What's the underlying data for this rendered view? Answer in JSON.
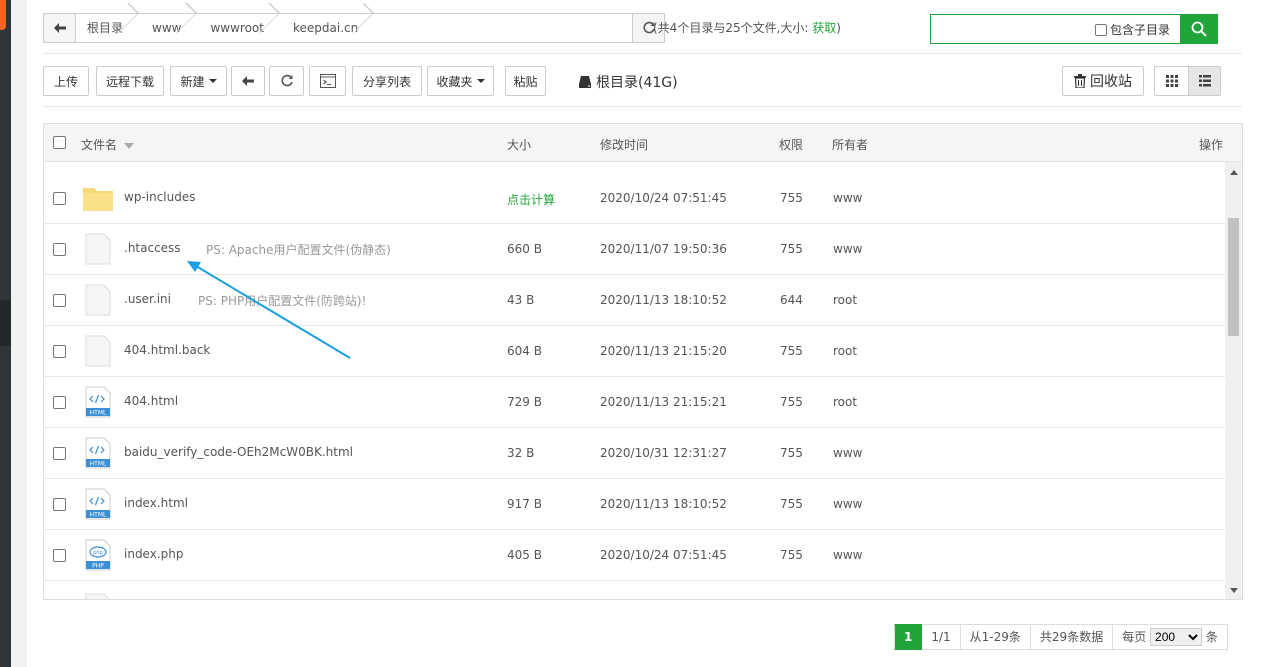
{
  "path": {
    "crumbs": [
      "根目录",
      "www",
      "wwwroot",
      "keepdai.cn"
    ],
    "summary_prefix": "(共4个目录与25个文件,大小: ",
    "summary_link": "获取",
    "summary_suffix": ")"
  },
  "search": {
    "placeholder": "",
    "include_subdir_label": "包含子目录"
  },
  "toolbar": {
    "upload": "上传",
    "remote_download": "远程下载",
    "new": "新建",
    "share_list": "分享列表",
    "favorites": "收藏夹",
    "paste": "粘贴",
    "disk_label": "根目录(41G)",
    "recycle_bin": "回收站"
  },
  "table": {
    "headers": {
      "name": "文件名",
      "size": "大小",
      "mtime": "修改时间",
      "perm": "权限",
      "owner": "所有者",
      "action": "操作"
    },
    "rows": [
      {
        "name": "wp-includes",
        "note": "",
        "size": "点击计算",
        "mtime": "2020/10/24 07:51:45",
        "perm": "755",
        "owner": "www",
        "icon": "folder-icon"
      },
      {
        "name": ".htaccess",
        "note": "PS: Apache用户配置文件(伪静态)",
        "size": "660 B",
        "mtime": "2020/11/07 19:50:36",
        "perm": "755",
        "owner": "www",
        "icon": "file-icon"
      },
      {
        "name": ".user.ini",
        "note": "PS: PHP用户配置文件(防跨站)!",
        "size": "43 B",
        "mtime": "2020/11/13 18:10:52",
        "perm": "644",
        "owner": "root",
        "icon": "file-icon"
      },
      {
        "name": "404.html.back",
        "note": "",
        "size": "604 B",
        "mtime": "2020/11/13 21:15:20",
        "perm": "755",
        "owner": "root",
        "icon": "file-icon"
      },
      {
        "name": "404.html",
        "note": "",
        "size": "729 B",
        "mtime": "2020/11/13 21:15:21",
        "perm": "755",
        "owner": "root",
        "icon": "html-file-icon"
      },
      {
        "name": "baidu_verify_code-OEh2McW0BK.html",
        "note": "",
        "size": "32 B",
        "mtime": "2020/10/31 12:31:27",
        "perm": "755",
        "owner": "www",
        "icon": "html-file-icon"
      },
      {
        "name": "index.html",
        "note": "",
        "size": "917 B",
        "mtime": "2020/11/13 18:10:52",
        "perm": "755",
        "owner": "www",
        "icon": "html-file-icon"
      },
      {
        "name": "index.php",
        "note": "",
        "size": "405 B",
        "mtime": "2020/10/24 07:51:45",
        "perm": "755",
        "owner": "www",
        "icon": "php-file-icon"
      }
    ]
  },
  "pager": {
    "current": "1",
    "pages": "1/1",
    "range": "从1-29条",
    "total": "共29条数据",
    "per_page_label": "每页",
    "per_page_value": "200",
    "unit": "条"
  },
  "colors": {
    "accent": "#20a53a",
    "annotation_arrow": "#1a9fe0"
  }
}
